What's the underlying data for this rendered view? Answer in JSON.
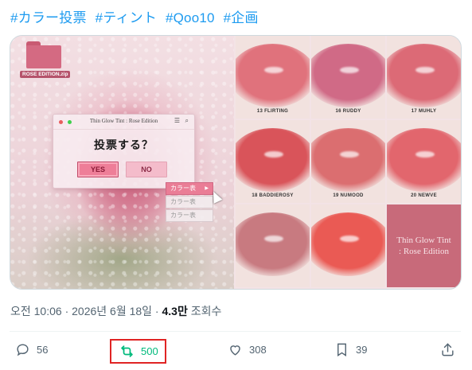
{
  "hashtags": [
    "#カラー投票",
    "#ティント",
    "#Qoo10",
    "#企画"
  ],
  "media": {
    "left": {
      "folder_label": "ROSE EDITION.zip",
      "dialog_title": "Thin Glow Tint : Rose Edition",
      "question": "投票する？",
      "yes": "YES",
      "no": "NO",
      "context_menu": [
        "カラー表",
        "カラー表",
        "カラー表"
      ]
    },
    "shades": [
      {
        "label": "13 FLIRTING",
        "color": "#e0727c"
      },
      {
        "label": "16 RUDDY",
        "color": "#d06a86"
      },
      {
        "label": "17 MUHLY",
        "color": "#dc6a76"
      },
      {
        "label": "18 BADDIEROSY",
        "color": "#d9545a"
      },
      {
        "label": "19 NUMOOD",
        "color": "#db6e70"
      },
      {
        "label": "20 NEWVE",
        "color": "#e2666d"
      },
      {
        "label": "",
        "color": "#c87a80"
      },
      {
        "label": "",
        "color": "#ea5a54"
      }
    ],
    "brand_tile": [
      "Thin Glow Tint",
      ": Rose Edition"
    ]
  },
  "meta": {
    "time": "오전 10:06 · 2026년 6월 18일 · ",
    "views": "4.3만",
    "views_label": " 조회수"
  },
  "actions": {
    "replies": "56",
    "retweets": "500",
    "likes": "308",
    "bookmarks": "39"
  },
  "colors": {
    "accent": "#1d9bf0",
    "retweet": "#00ba7c",
    "highlight_box": "#e02424",
    "muted": "#536471"
  }
}
